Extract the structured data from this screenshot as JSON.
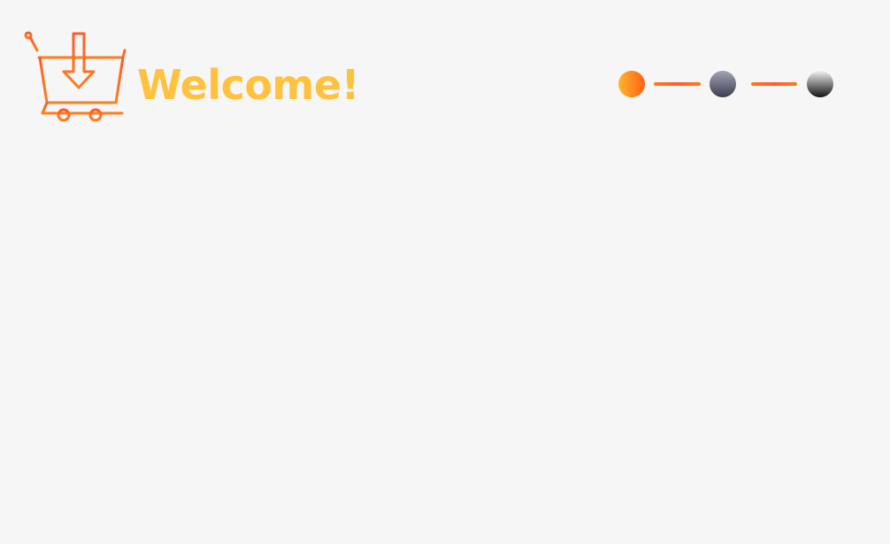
{
  "header": {
    "logo_icon": "cart-download-icon",
    "title": "Welcome!",
    "title_color": "#ffc23f"
  },
  "stepper": {
    "steps": [
      {
        "state": "active",
        "color": "#ff7a1c"
      },
      {
        "state": "inactive",
        "color": "#6b6b80"
      },
      {
        "state": "inactive",
        "color": "#141414"
      }
    ],
    "connector_color": "#ff5a3a"
  }
}
